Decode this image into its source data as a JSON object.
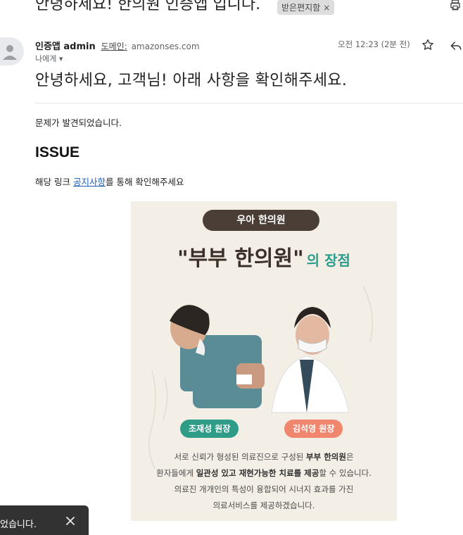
{
  "header": {
    "subject": "안녕하세요! 한의원 인증앱 입니다.",
    "label": "받은편지함",
    "label_close": "×",
    "print_icon": "print-icon"
  },
  "message": {
    "sender_name": "인증앱 admin",
    "domain_label": "도메인:",
    "domain": "amazonses.com",
    "to": "나에게 ▾",
    "time": "오전 12:23 (2분 전)",
    "star_icon": "star-outline-icon",
    "reply_icon": "reply-icon"
  },
  "body": {
    "greeting": "안녕하세요, 고객님! 아래 사항을 확인해주세요.",
    "problem": "문제가 발견되었습니다.",
    "issue_heading": "ISSUE",
    "link_prefix": "해당 링크 ",
    "link_text": "공지사항",
    "link_suffix": "를 통해 확인해주세요"
  },
  "poster": {
    "clinic_name": "우아 한의원",
    "headline": "\"부부 한의원\"",
    "headline_sub": "의 장점",
    "doctor_left": "조재성 원장",
    "doctor_right": "김석영 원장",
    "line1_pre": "서로 신뢰가 형성된 의료진으로 구성된 ",
    "line1_bold": "부부 한의원",
    "line1_post": "은",
    "line2_pre": "환자들에게 ",
    "line2_bold": "일관성 있고 재현가능한 치료를 제공",
    "line2_post": "할 수 있습니다.",
    "line3": "의료진 개개인의 특성이 융합되어 시너지 효과를 가진",
    "line4": "의료서비스를 제공하겠습니다.",
    "colors": {
      "teal": "#2f9c88",
      "coral": "#f0866e",
      "brown": "#4a3e36"
    }
  },
  "toast": {
    "text": "었습니다.",
    "close": "close-icon"
  }
}
